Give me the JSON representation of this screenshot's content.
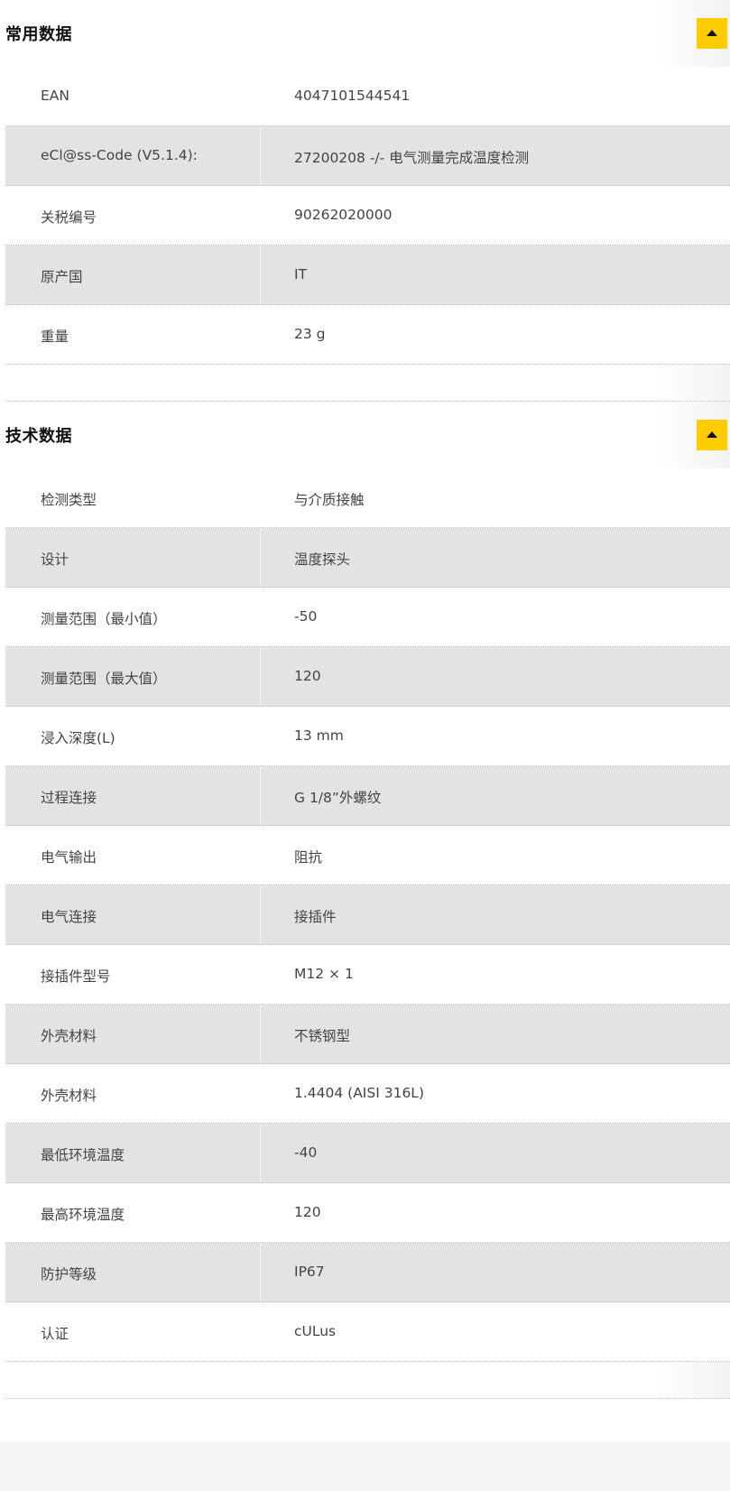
{
  "sections": [
    {
      "title": "常用数据",
      "rows": [
        {
          "label": "EAN",
          "value": "4047101544541"
        },
        {
          "label": "eCl@ss-Code (V5.1.4):",
          "value": "27200208 -/- 电气测量完成温度检测"
        },
        {
          "label": "关税编号",
          "value": "90262020000"
        },
        {
          "label": "原产国",
          "value": "IT"
        },
        {
          "label": "重量",
          "value": "23 g"
        }
      ]
    },
    {
      "title": "技术数据",
      "rows": [
        {
          "label": "检测类型",
          "value": "与介质接触"
        },
        {
          "label": "设计",
          "value": "温度探头"
        },
        {
          "label": "测量范围（最小值）",
          "value": "-50"
        },
        {
          "label": "测量范围（最大值）",
          "value": "120"
        },
        {
          "label": "浸入深度(L)",
          "value": "13  mm"
        },
        {
          "label": "过程连接",
          "value": "G 1/8”外螺纹"
        },
        {
          "label": "电气输出",
          "value": "阻抗"
        },
        {
          "label": "电气连接",
          "value": "接插件"
        },
        {
          "label": "接插件型号",
          "value": "M12 × 1"
        },
        {
          "label": "外壳材料",
          "value": "不锈钢型"
        },
        {
          "label": "外壳材料",
          "value": "1.4404 (AISI 316L)"
        },
        {
          "label": "最低环境温度",
          "value": "-40"
        },
        {
          "label": "最高环境温度",
          "value": "120"
        },
        {
          "label": "防护等级",
          "value": "IP67"
        },
        {
          "label": "认证",
          "value": "cULus"
        }
      ]
    }
  ],
  "icons": {
    "toggle": "caret-up-icon"
  },
  "colors": {
    "accent": "#ffcc00",
    "row_shade": "#e3e3e3"
  }
}
